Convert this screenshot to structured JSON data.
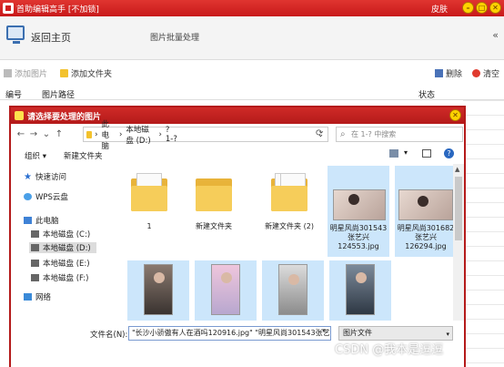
{
  "window": {
    "title": "首助编辑高手 [不加锁]",
    "skin": "皮肤",
    "minimize": "–",
    "maximize": "□",
    "close": "✕"
  },
  "top_bar": {
    "back": "返回主页",
    "section_title": "图片批量处理",
    "collapse": "«"
  },
  "toolbar": {
    "add_image": "添加图片",
    "add_folder": "添加文件夹",
    "delete": "删除",
    "clear": "清空"
  },
  "list_header": {
    "col_num": "编号",
    "col_path": "图片路径",
    "col_status": "状态"
  },
  "dialog": {
    "title": "请选择要处理的图片",
    "nav": {
      "back": "←",
      "forward": "→",
      "down": "⌄",
      "up": "↑"
    },
    "address": {
      "part1": "此电脑",
      "part2": "本地磁盘 (D:)",
      "part3": "?1-?",
      "sep": "›",
      "dropdown": "⌄",
      "refresh": "⟳"
    },
    "search_placeholder": "在 1-? 中搜索",
    "organize": "组织 ▾",
    "new_folder": "新建文件夹",
    "view_arrow": "▾",
    "help": "?",
    "nav_pane": [
      {
        "label": "快速访问"
      },
      {
        "label": "WPS云盘"
      },
      {
        "label": "此电脑"
      },
      {
        "label": "本地磁盘 (C:)"
      },
      {
        "label": "本地磁盘 (D:)"
      },
      {
        "label": "本地磁盘 (E:)"
      },
      {
        "label": "本地磁盘 (F:)"
      },
      {
        "label": "网络"
      }
    ],
    "files": [
      {
        "name": "1"
      },
      {
        "name": "新建文件夹"
      },
      {
        "name": "新建文件夹 (2)"
      },
      {
        "name": "明星风尚301543张艺兴124553.jpg"
      },
      {
        "name": "明星风尚301682张艺兴126294.jpg"
      }
    ],
    "filename_label": "文件名(N):",
    "filename_value": "\"长沙小骄傲有人在酒吗120916.jpg\" \"明星风尚301543张艺",
    "filter": "图片文件",
    "dropdown": "▾"
  },
  "watermark": "CSDN @我本是逗逗"
}
